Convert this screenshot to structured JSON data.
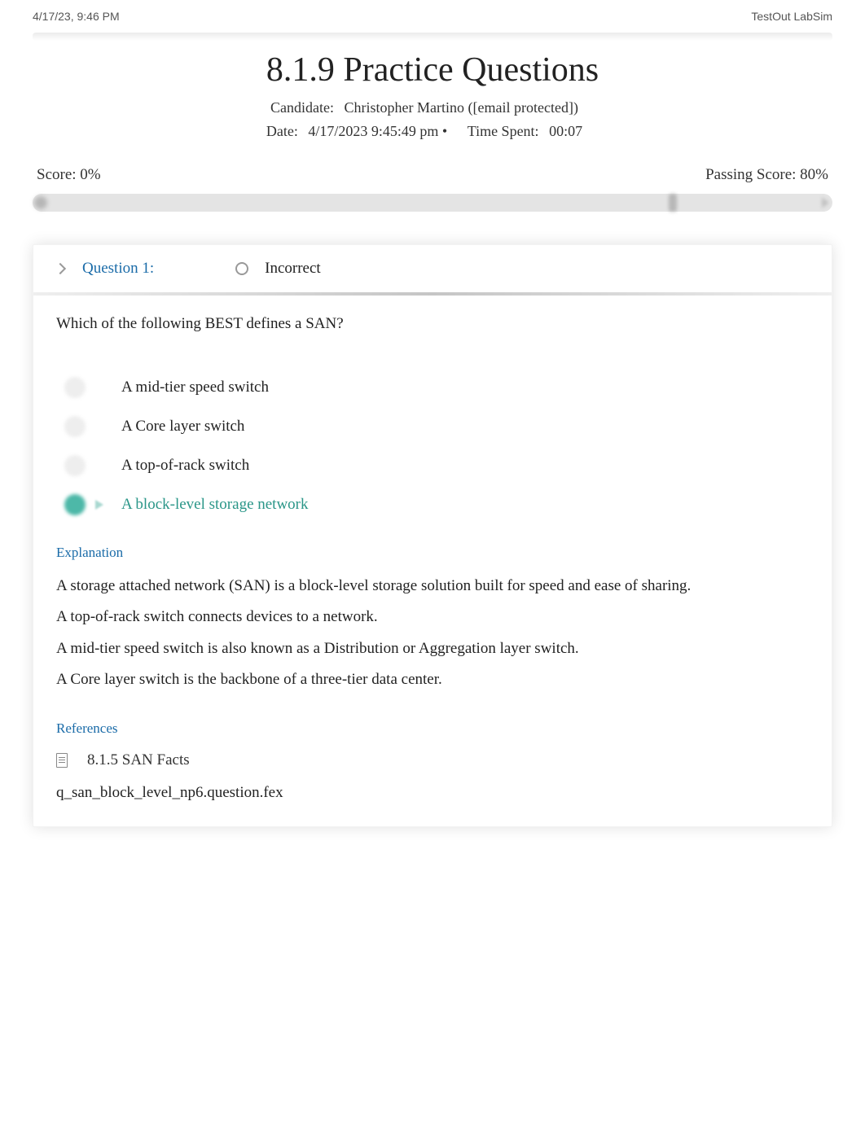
{
  "header": {
    "timestamp": "4/17/23, 9:46 PM",
    "app_name": "TestOut LabSim"
  },
  "title": "8.1.9 Practice Questions",
  "candidate": {
    "label": "Candidate:",
    "value": "Christopher Martino ([email protected])"
  },
  "date": {
    "label": "Date:",
    "value": "4/17/2023 9:45:49 pm •"
  },
  "time_spent": {
    "label": "Time Spent:",
    "value": "00:07"
  },
  "score": {
    "label": "Score: 0%",
    "passing": "Passing Score: 80%"
  },
  "question": {
    "label": "Question 1:",
    "status": "Incorrect",
    "text": "Which of the following BEST defines a SAN?",
    "answers": [
      {
        "text": "A mid-tier speed switch",
        "correct": false
      },
      {
        "text": "A Core layer switch",
        "correct": false
      },
      {
        "text": "A top-of-rack switch",
        "correct": false
      },
      {
        "text": "A block-level storage network",
        "correct": true
      }
    ],
    "explanation_heading": "Explanation",
    "explanation": [
      "A storage attached network (SAN) is a block-level storage solution built for speed and ease of sharing.",
      "A top-of-rack switch connects devices to a network.",
      "A mid-tier speed switch is also known as a Distribution or Aggregation layer switch.",
      "A Core layer switch is the backbone of a three-tier data center."
    ],
    "references_heading": "References",
    "references": [
      "8.1.5 SAN Facts"
    ],
    "file": "q_san_block_level_np6.question.fex"
  }
}
